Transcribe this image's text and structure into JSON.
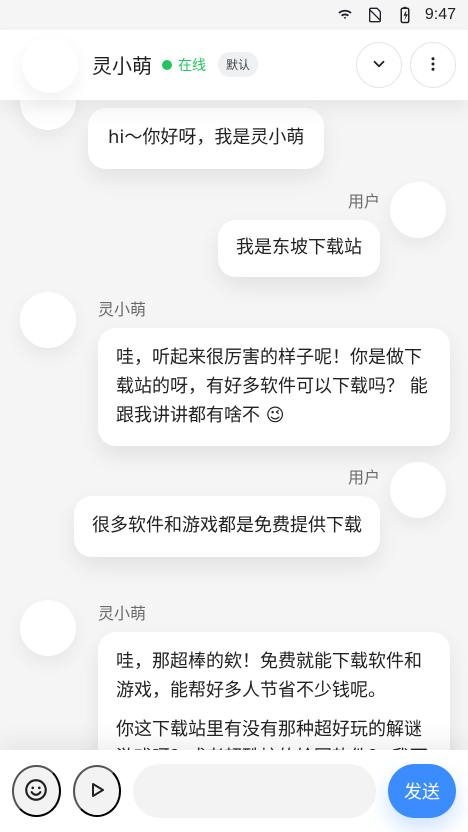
{
  "status_bar": {
    "time": "9:47",
    "icons": [
      "wifi-icon",
      "no-sim-icon",
      "battery-charging-icon"
    ]
  },
  "header": {
    "name": "灵小萌",
    "online_label": "在线",
    "badge": "默认",
    "actions": [
      "chevron-down-icon",
      "more-vertical-icon"
    ]
  },
  "chat": {
    "messages": [
      {
        "sender": "",
        "side": "left",
        "paragraphs": [
          "hi～你好呀，我是灵小萌"
        ]
      },
      {
        "sender": "用户",
        "side": "right",
        "paragraphs": [
          "我是东坡下载站"
        ]
      },
      {
        "sender": "灵小萌",
        "side": "left",
        "paragraphs": [
          "哇，听起来很厉害的样子呢！你是做下载站的呀，有好多软件可以下载吗？ 能跟我讲讲都有啥不"
        ],
        "emoji": "😉"
      },
      {
        "sender": "用户",
        "side": "right",
        "paragraphs": [
          "很多软件和游戏都是免费提供下载"
        ]
      },
      {
        "sender": "灵小萌",
        "side": "left",
        "paragraphs": [
          "哇，那超棒的欸！免费就能下载软件和游戏，能帮好多人节省不少钱呢。",
          "你这下载站里有没有那种超好玩的解谜游戏呀？或者超酷炫的绘图软件？ 我可"
        ]
      }
    ]
  },
  "input_bar": {
    "placeholder": "",
    "send_label": "发送",
    "icons": [
      "emoji-icon",
      "play-icon"
    ]
  },
  "colors": {
    "primary": "#3b8cff",
    "online_green": "#22c55e"
  }
}
